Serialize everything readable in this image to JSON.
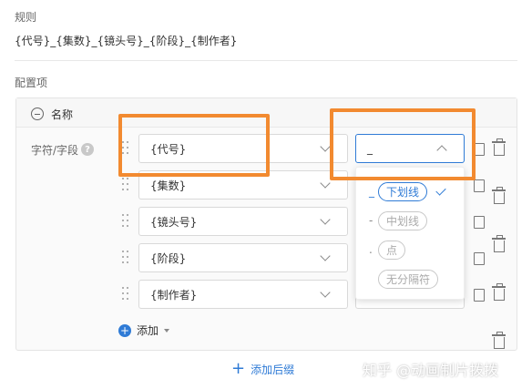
{
  "rule": {
    "label": "规则",
    "value": "{代号}_{集数}_{镜头号}_{阶段}_{制作者}"
  },
  "config": {
    "label": "配置项"
  },
  "panel": {
    "title": "名称"
  },
  "field": {
    "label": "字符/字段",
    "help": "?"
  },
  "rows": [
    {
      "field": "{代号}",
      "separator": "_"
    },
    {
      "field": "{集数}"
    },
    {
      "field": "{镜头号}"
    },
    {
      "field": "{阶段}"
    },
    {
      "field": "{制作者}"
    }
  ],
  "dropdown": {
    "options": [
      {
        "symbol": "_",
        "label": "下划线",
        "selected": true
      },
      {
        "symbol": "-",
        "label": "中划线",
        "selected": false
      },
      {
        "symbol": ".",
        "label": "点",
        "selected": false
      },
      {
        "symbol": "",
        "label": "无分隔符",
        "selected": false
      }
    ]
  },
  "actions": {
    "add": "添加",
    "add_plus": "+",
    "add_suffix": "添加后缀",
    "add_suffix_plus": "+"
  },
  "watermark": "知乎 @动画制片拨拨",
  "colors": {
    "accent": "#2f7bd6",
    "highlight": "#f28a30"
  }
}
